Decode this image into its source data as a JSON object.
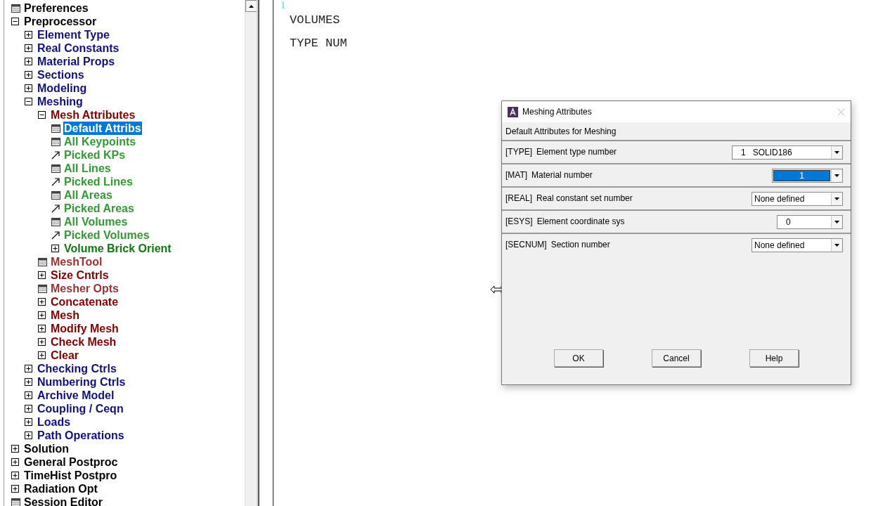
{
  "tree": [
    {
      "label": "Preferences",
      "kind": "dialog",
      "color": "#000000",
      "selected": false
    },
    {
      "label": "Preprocessor",
      "kind": "folder",
      "expanded": true,
      "color": "#000000",
      "selected": false,
      "children": [
        {
          "label": "Element Type",
          "kind": "folder",
          "expanded": false,
          "color": "#10107a",
          "selected": false
        },
        {
          "label": "Real Constants",
          "kind": "folder",
          "expanded": false,
          "color": "#10107a",
          "selected": false
        },
        {
          "label": "Material Props",
          "kind": "folder",
          "expanded": false,
          "color": "#10107a",
          "selected": false
        },
        {
          "label": "Sections",
          "kind": "folder",
          "expanded": false,
          "color": "#10107a",
          "selected": false
        },
        {
          "label": "Modeling",
          "kind": "folder",
          "expanded": false,
          "color": "#10107a",
          "selected": false
        },
        {
          "label": "Meshing",
          "kind": "folder",
          "expanded": true,
          "color": "#10107a",
          "selected": false,
          "children": [
            {
              "label": "Mesh Attributes",
              "kind": "folder",
              "expanded": true,
              "color": "#800000",
              "selected": false,
              "children": [
                {
                  "label": "Default Attribs",
                  "kind": "dialog",
                  "selected": true
                },
                {
                  "label": "All Keypoints",
                  "kind": "dialog",
                  "color": "#339933",
                  "selected": false
                },
                {
                  "label": "Picked KPs",
                  "kind": "picker",
                  "color": "#339933",
                  "selected": false
                },
                {
                  "label": "All Lines",
                  "kind": "dialog",
                  "color": "#339933",
                  "selected": false
                },
                {
                  "label": "Picked Lines",
                  "kind": "picker",
                  "color": "#339933",
                  "selected": false
                },
                {
                  "label": "All Areas",
                  "kind": "dialog",
                  "color": "#339933",
                  "selected": false
                },
                {
                  "label": "Picked Areas",
                  "kind": "picker",
                  "color": "#339933",
                  "selected": false
                },
                {
                  "label": "All Volumes",
                  "kind": "dialog",
                  "color": "#339933",
                  "selected": false
                },
                {
                  "label": "Picked Volumes",
                  "kind": "picker",
                  "color": "#339933",
                  "selected": false
                },
                {
                  "label": "Volume Brick Orient",
                  "kind": "folder",
                  "expanded": false,
                  "color": "#117711",
                  "selected": false
                }
              ]
            },
            {
              "label": "MeshTool",
              "kind": "dialog",
              "color": "#993333",
              "selected": false
            },
            {
              "label": "Size Cntrls",
              "kind": "folder",
              "expanded": false,
              "color": "#800000",
              "selected": false
            },
            {
              "label": "Mesher Opts",
              "kind": "dialog",
              "color": "#993333",
              "selected": false
            },
            {
              "label": "Concatenate",
              "kind": "folder",
              "expanded": false,
              "color": "#800000",
              "selected": false
            },
            {
              "label": "Mesh",
              "kind": "folder",
              "expanded": false,
              "color": "#800000",
              "selected": false
            },
            {
              "label": "Modify Mesh",
              "kind": "folder",
              "expanded": false,
              "color": "#800000",
              "selected": false
            },
            {
              "label": "Check Mesh",
              "kind": "folder",
              "expanded": false,
              "color": "#800000",
              "selected": false
            },
            {
              "label": "Clear",
              "kind": "folder",
              "expanded": false,
              "color": "#800000",
              "selected": false
            }
          ]
        },
        {
          "label": "Checking Ctrls",
          "kind": "folder",
          "expanded": false,
          "color": "#10107a",
          "selected": false
        },
        {
          "label": "Numbering Ctrls",
          "kind": "folder",
          "expanded": false,
          "color": "#10107a",
          "selected": false
        },
        {
          "label": "Archive Model",
          "kind": "folder",
          "expanded": false,
          "color": "#10107a",
          "selected": false
        },
        {
          "label": "Coupling / Ceqn",
          "kind": "folder",
          "expanded": false,
          "color": "#10107a",
          "selected": false
        },
        {
          "label": "Loads",
          "kind": "folder",
          "expanded": false,
          "color": "#10107a",
          "selected": false
        },
        {
          "label": "Path Operations",
          "kind": "folder",
          "expanded": false,
          "color": "#10107a",
          "selected": false
        }
      ]
    },
    {
      "label": "Solution",
      "kind": "folder",
      "expanded": false,
      "color": "#000000",
      "selected": false
    },
    {
      "label": "General Postproc",
      "kind": "folder",
      "expanded": false,
      "color": "#000000",
      "selected": false
    },
    {
      "label": "TimeHist Postpro",
      "kind": "folder",
      "expanded": false,
      "color": "#000000",
      "selected": false
    },
    {
      "label": "Radiation Opt",
      "kind": "folder",
      "expanded": false,
      "color": "#000000",
      "selected": false
    },
    {
      "label": "Session Editor",
      "kind": "dialog",
      "color": "#000000",
      "selected": false
    }
  ],
  "graphics": {
    "window_number": "1",
    "lines": [
      "VOLUMES",
      "TYPE NUM"
    ]
  },
  "dialog": {
    "title": "Meshing Attributes",
    "heading": "Default Attributes for Meshing",
    "fields": [
      {
        "tag": "[TYPE]",
        "label": "Element type number",
        "value": "1   SOLID186",
        "selected": false
      },
      {
        "tag": "[MAT]",
        "label": "Material number",
        "value": "1",
        "selected": true
      },
      {
        "tag": "[REAL]",
        "label": "Real constant set number",
        "value": "None defined",
        "selected": false
      },
      {
        "tag": "[ESYS]",
        "label": "Element coordinate sys",
        "value": "0",
        "selected": false
      },
      {
        "tag": "[SECNUM]",
        "label": "Section number",
        "value": "None defined",
        "selected": false
      }
    ],
    "buttons": [
      "OK",
      "Cancel",
      "Help"
    ]
  }
}
